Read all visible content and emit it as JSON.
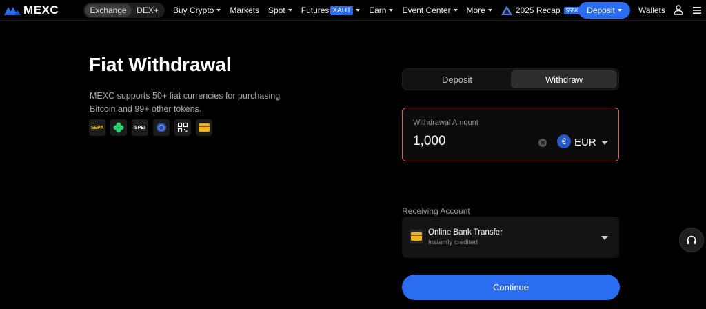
{
  "brand": {
    "name": "MEXC"
  },
  "nav": {
    "segment": [
      "Exchange",
      "DEX+"
    ],
    "items": [
      {
        "label": "Buy Crypto",
        "caret": true
      },
      {
        "label": "Markets",
        "caret": false
      },
      {
        "label": "Spot",
        "caret": true
      },
      {
        "label": "Futures",
        "tag": "XAUT",
        "caret": true
      },
      {
        "label": "Earn",
        "caret": true
      },
      {
        "label": "Event Center",
        "caret": true
      },
      {
        "label": "More",
        "caret": true
      }
    ],
    "recap": {
      "label": "2025 Recap",
      "badge": "$55K"
    },
    "deposit_label": "Deposit",
    "wallets_label": "Wallets"
  },
  "hero": {
    "title": "Fiat Withdrawal",
    "description": "MEXC supports 50+ fiat currencies for purchasing Bitcoin and 99+ other tokens.",
    "payment_icons": [
      "sepa-icon",
      "clover-icon",
      "spei-icon",
      "pay-icon",
      "qr-code-icon",
      "card-icon"
    ],
    "sepa_text": "SEPA",
    "spei_text": "SPEI"
  },
  "panel": {
    "tabs": {
      "deposit": "Deposit",
      "withdraw": "Withdraw"
    },
    "amount": {
      "label": "Withdrawal Amount",
      "value": "1,000",
      "currency": "EUR",
      "currency_symbol": "€"
    },
    "receiving": {
      "label": "Receiving Account",
      "method": "Online Bank Transfer",
      "subtitle": "Instantly credited"
    },
    "continue_label": "Continue"
  },
  "colors": {
    "accent": "#2a6df0",
    "error_border": "#e05a5a",
    "background": "#000000"
  }
}
